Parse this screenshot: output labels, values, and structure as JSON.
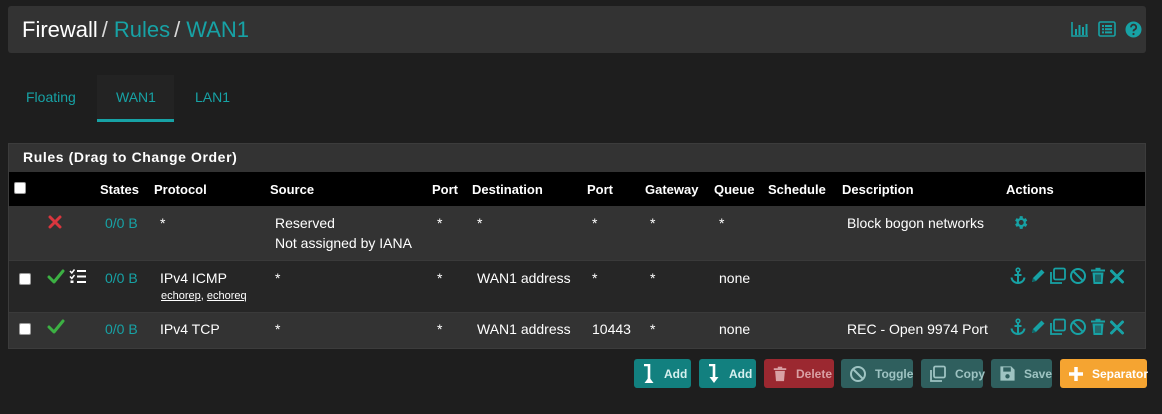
{
  "breadcrumb": {
    "first": "Firewall",
    "second": "Rules",
    "third": "WAN1",
    "sep": "/"
  },
  "top_icons": [
    "bar-chart-icon",
    "list-icon",
    "help-icon"
  ],
  "tabs": [
    {
      "label": "Floating",
      "active": false
    },
    {
      "label": "WAN1",
      "active": true
    },
    {
      "label": "LAN1",
      "active": false
    }
  ],
  "panel": {
    "title": "Rules (Drag to Change Order)"
  },
  "columns": {
    "states": "States",
    "protocol": "Protocol",
    "source": "Source",
    "port": "Port",
    "destination": "Destination",
    "dport": "Port",
    "gateway": "Gateway",
    "queue": "Queue",
    "schedule": "Schedule",
    "description": "Description",
    "actions": "Actions"
  },
  "rows": [
    {
      "status": "block",
      "states": "0/0 B",
      "protocol": "*",
      "source_line1": "Reserved",
      "source_line2": "Not assigned by IANA",
      "port": "*",
      "destination": "*",
      "dport": "*",
      "gateway": "*",
      "queue": "*",
      "schedule": "",
      "description": "Block bogon networks"
    },
    {
      "status": "pass",
      "states": "0/0 B",
      "protocol": "IPv4 ICMP",
      "protocol_sub1": "echorep",
      "protocol_sub_sep": ",",
      "protocol_sub2": "echoreq",
      "source": "*",
      "port": "*",
      "destination": "WAN1 address",
      "dport": "*",
      "gateway": "*",
      "queue": "none",
      "schedule": "",
      "description": ""
    },
    {
      "status": "pass",
      "states": "0/0 B",
      "protocol": "IPv4 TCP",
      "source": "*",
      "port": "*",
      "destination": "WAN1 address",
      "dport": "10443",
      "gateway": "*",
      "queue": "none",
      "schedule": "",
      "description": "REC - Open 9974 Port"
    }
  ],
  "buttons": {
    "add_top": "Add",
    "add_bottom": "Add",
    "delete": "Delete",
    "toggle": "Toggle",
    "copy": "Copy",
    "save": "Save",
    "separator": "Separator"
  },
  "colors": {
    "accent": "#17a2a5",
    "pass": "#3cb043",
    "block": "#d9363e",
    "separator": "#f5a431",
    "delete": "#9b2830"
  }
}
